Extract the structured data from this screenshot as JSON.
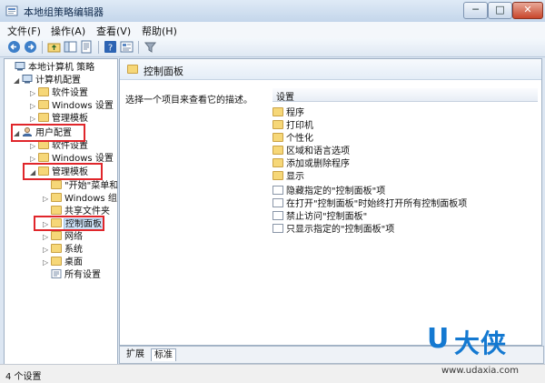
{
  "window": {
    "title": "本地组策略编辑器",
    "minimize": "─",
    "maximize": "□",
    "close": "✕"
  },
  "menu": [
    "文件(F)",
    "操作(A)",
    "查看(V)",
    "帮助(H)"
  ],
  "tree": [
    {
      "label": "本地计算机 策略",
      "icon": "computer-icon",
      "arrow": ""
    },
    {
      "label": "计算机配置",
      "icon": "computer-config-icon",
      "arrow": "◢"
    },
    {
      "label": "软件设置",
      "icon": "folder-icon",
      "arrow": "▷"
    },
    {
      "label": "Windows 设置",
      "icon": "folder-icon",
      "arrow": "▷"
    },
    {
      "label": "管理模板",
      "icon": "folder-icon",
      "arrow": "▷"
    },
    {
      "label": "用户配置",
      "icon": "user-config-icon",
      "arrow": "◢"
    },
    {
      "label": "软件设置",
      "icon": "folder-icon",
      "arrow": "▷"
    },
    {
      "label": "Windows 设置",
      "icon": "folder-icon",
      "arrow": "▷"
    },
    {
      "label": "管理模板",
      "icon": "folder-icon",
      "arrow": "◢"
    },
    {
      "label": "\"开始\"菜单和",
      "icon": "folder-icon",
      "arrow": ""
    },
    {
      "label": "Windows 组件",
      "icon": "folder-icon",
      "arrow": "▷"
    },
    {
      "label": "共享文件夹",
      "icon": "folder-icon",
      "arrow": ""
    },
    {
      "label": "控制面板",
      "icon": "folder-icon",
      "arrow": "▷"
    },
    {
      "label": "网络",
      "icon": "folder-icon",
      "arrow": "▷"
    },
    {
      "label": "系统",
      "icon": "folder-icon",
      "arrow": "▷"
    },
    {
      "label": "桌面",
      "icon": "folder-icon",
      "arrow": "▷"
    },
    {
      "label": "所有设置",
      "icon": "settings-icon",
      "arrow": ""
    }
  ],
  "right": {
    "header": "控制面板",
    "description": "选择一个项目来查看它的描述。",
    "column": "设置",
    "items": [
      {
        "label": "程序",
        "type": "folder"
      },
      {
        "label": "打印机",
        "type": "folder"
      },
      {
        "label": "个性化",
        "type": "folder"
      },
      {
        "label": "区域和语言选项",
        "type": "folder"
      },
      {
        "label": "添加或删除程序",
        "type": "folder"
      },
      {
        "label": "显示",
        "type": "folder"
      },
      {
        "label": "隐藏指定的\"控制面板\"项",
        "type": "policy"
      },
      {
        "label": "在打开\"控制面板\"时始终打开所有控制面板项",
        "type": "policy"
      },
      {
        "label": "禁止访问\"控制面板\"",
        "type": "policy"
      },
      {
        "label": "只显示指定的\"控制面板\"项",
        "type": "policy"
      }
    ]
  },
  "tabs": [
    "扩展",
    "标准"
  ],
  "status": "4 个设置",
  "watermark": {
    "logo_u": "U",
    "logo_text": "大侠",
    "url": "www.udaxia.com"
  },
  "colors": {
    "highlight_box": "#e0262b",
    "watermark_blue": "#1479d1"
  }
}
